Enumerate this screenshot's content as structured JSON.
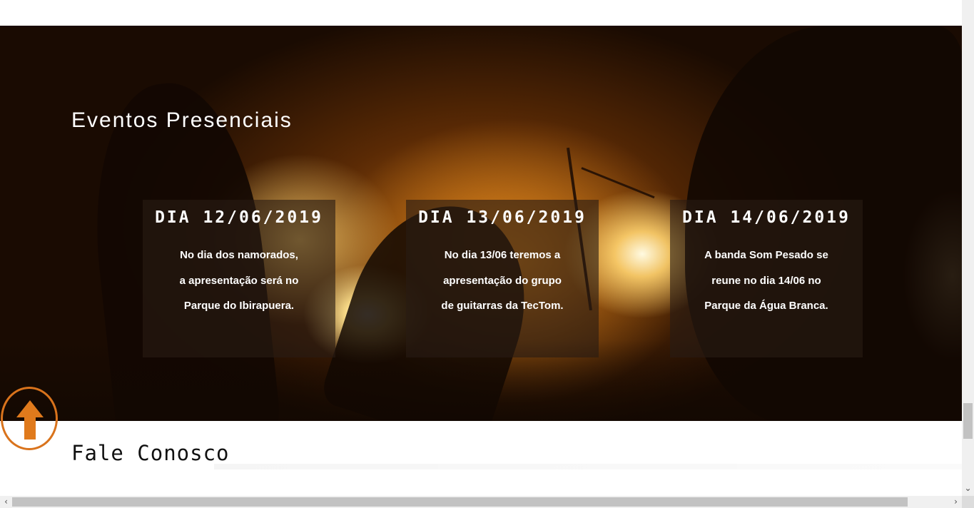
{
  "events": {
    "title": "Eventos Presenciais",
    "cards": [
      {
        "date": "DIA 12/06/2019",
        "lines": [
          "No dia dos namorados,",
          "a apresentação será no",
          "Parque do Ibirapuera."
        ]
      },
      {
        "date": "DIA 13/06/2019",
        "lines": [
          "No dia 13/06 teremos a",
          "apresentação do grupo",
          "de guitarras da TecTom."
        ]
      },
      {
        "date": "DIA 14/06/2019",
        "lines": [
          "A banda Som Pesado se",
          "reune no dia 14/06 no",
          "Parque da Água Branca."
        ]
      }
    ]
  },
  "contact": {
    "title": "Fale Conosco"
  },
  "scroll_top_button": {
    "icon": "arrow-up-icon",
    "color": "#d9731c"
  },
  "scrollbars": {
    "left_arrow": "‹",
    "right_arrow": "›",
    "down_arrow": "⌄"
  }
}
